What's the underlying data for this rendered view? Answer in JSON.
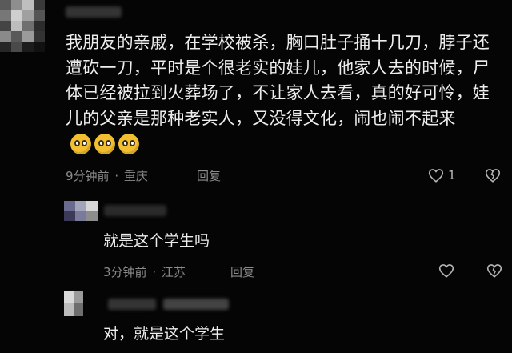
{
  "comments": [
    {
      "text": "我朋友的亲戚，在学校被杀，胸口肚子捅十几刀，脖子还遭砍一刀，平时是个很老实的娃儿，他家人去的时候，尸体已经被拉到火葬场了，不让家人去看，真的好可怜，娃儿的父亲是那种老实人，又没得文化，闹也闹不起来",
      "emojis": [
        "pleading-emoji",
        "pleading-emoji",
        "pleading-emoji"
      ],
      "time": "9分钟前",
      "location": "重庆",
      "reply_label": "回复",
      "like_count": "1"
    }
  ],
  "replies": [
    {
      "text": "就是这个学生吗",
      "time": "3分钟前",
      "location": "江苏",
      "reply_label": "回复"
    },
    {
      "text": "对，就是这个学生"
    }
  ],
  "meta_separator": "·",
  "colors": {
    "background": "#050505",
    "text": "#ededed",
    "meta": "#8b8b8b",
    "emoji": "#f1bf2f"
  }
}
